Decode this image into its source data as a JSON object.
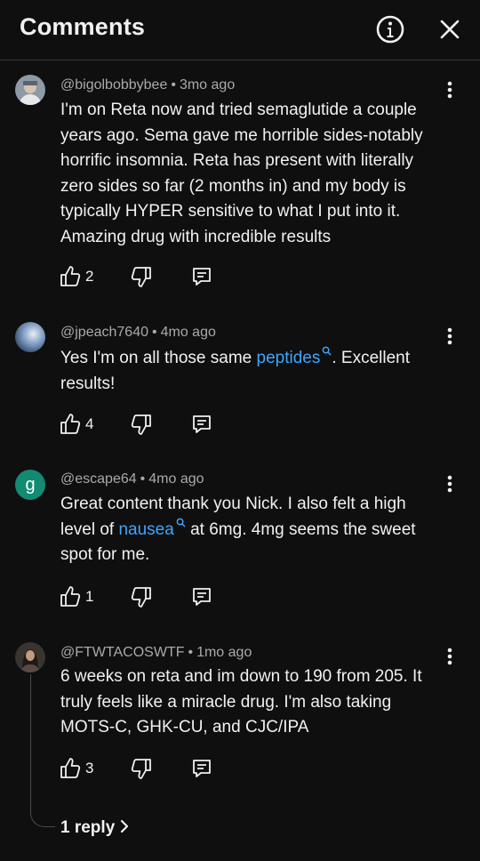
{
  "header": {
    "title": "Comments"
  },
  "comments": [
    {
      "author": "@bigolbobbybee",
      "time": "3mo ago",
      "text_parts": [
        "I'm on Reta now and tried semaglutide a couple years ago. Sema gave me horrible sides-notably horrific insomnia. Reta has present with literally zero sides so far (2 months in) and my body is typically HYPER sensitive to what I put into it. Amazing drug with incredible results"
      ],
      "likes": "2"
    },
    {
      "author": "@jpeach7640",
      "time": "4mo ago",
      "text_before": "Yes I'm on all those same ",
      "link": "peptides",
      "text_after": ". Excellent results!",
      "likes": "4"
    },
    {
      "author": "@escape64",
      "avatar_letter": "g",
      "time": "4mo ago",
      "text_before": "Great content thank you Nick.  I also felt a high level of ",
      "link": "nausea",
      "text_after": " at 6mg.  4mg seems the sweet spot for me.",
      "likes": "1"
    },
    {
      "author": "@FTWTACOSWTF",
      "time": "1mo ago",
      "text_parts": [
        "6 weeks on reta and im down to 190 from 205. It truly feels like a miracle drug. I'm also taking MOTS-C, GHK-CU, and CJC/IPA"
      ],
      "likes": "3",
      "replies_label": "1 reply"
    }
  ],
  "colors": {
    "background": "#0f0f0f",
    "link": "#3ea6ff",
    "avatar_g": "#138a72"
  },
  "icons": [
    "info-icon",
    "close-icon",
    "more-vert-icon",
    "thumb-up-icon",
    "thumb-down-icon",
    "reply-comment-icon",
    "chevron-right-icon",
    "search-icon"
  ]
}
